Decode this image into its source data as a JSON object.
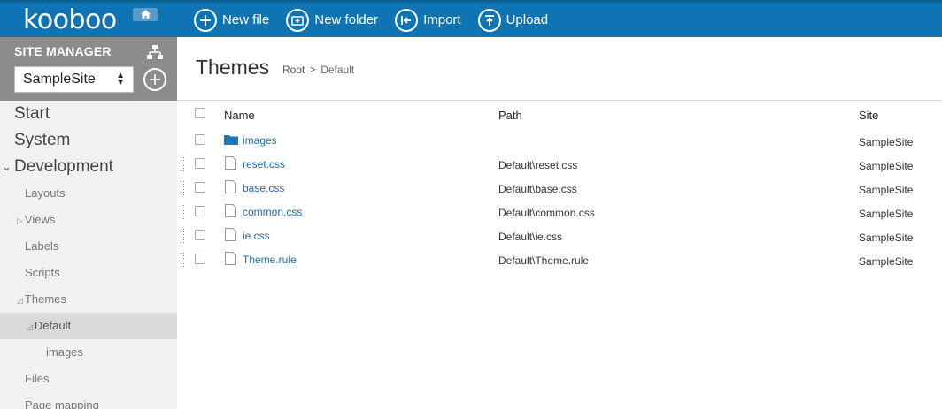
{
  "app": {
    "logo": "kooboo"
  },
  "toolbar": {
    "buttons": [
      {
        "label": "New file",
        "icon": "plus-icon"
      },
      {
        "label": "New folder",
        "icon": "new-folder-icon"
      },
      {
        "label": "Import",
        "icon": "import-icon"
      },
      {
        "label": "Upload",
        "icon": "upload-icon"
      }
    ]
  },
  "sidebar": {
    "title": "SITE MANAGER",
    "site_select": "SampleSite",
    "nav": [
      {
        "label": "Start"
      },
      {
        "label": "System"
      },
      {
        "label": "Development"
      }
    ],
    "dev_items": [
      {
        "label": "Layouts"
      },
      {
        "label": "Views"
      },
      {
        "label": "Labels"
      },
      {
        "label": "Scripts"
      },
      {
        "label": "Themes"
      },
      {
        "label": "Default"
      },
      {
        "label": "images"
      },
      {
        "label": "Files"
      },
      {
        "label": "Page mapping"
      }
    ]
  },
  "main": {
    "title": "Themes",
    "breadcrumb": {
      "root": "Root",
      "current": "Default"
    },
    "columns": {
      "name": "Name",
      "path": "Path",
      "site": "Site"
    },
    "rows": [
      {
        "name": "images",
        "type": "folder",
        "path": "",
        "site": "SampleSite"
      },
      {
        "name": "reset.css",
        "type": "file",
        "path": "Default\\reset.css",
        "site": "SampleSite"
      },
      {
        "name": "base.css",
        "type": "file",
        "path": "Default\\base.css",
        "site": "SampleSite"
      },
      {
        "name": "common.css",
        "type": "file",
        "path": "Default\\common.css",
        "site": "SampleSite"
      },
      {
        "name": "ie.css",
        "type": "file",
        "path": "Default\\ie.css",
        "site": "SampleSite"
      },
      {
        "name": "Theme.rule",
        "type": "file",
        "path": "Default\\Theme.rule",
        "site": "SampleSite"
      }
    ]
  },
  "colors": {
    "brand": "#0f74b4",
    "link": "#1f6aa5",
    "sidebar_head": "#8c8c8c"
  }
}
